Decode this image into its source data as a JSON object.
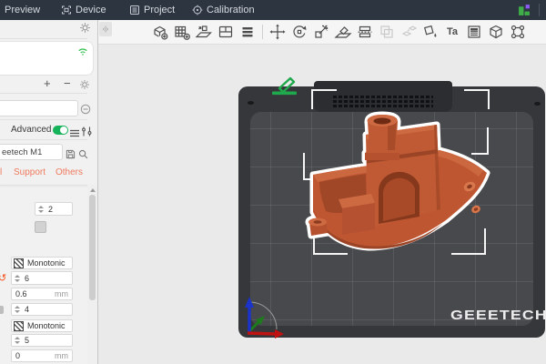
{
  "topbar": {
    "tabs": [
      {
        "label": "Preview"
      },
      {
        "label": "Device"
      },
      {
        "label": "Project"
      },
      {
        "label": "Calibration"
      }
    ]
  },
  "viewport_toolbar": {
    "text_icon_label": "Ta",
    "icons": [
      "add-object",
      "add-plate",
      "auto-arrange",
      "split-view",
      "layers",
      "move",
      "rotate",
      "scale",
      "lay-on-face",
      "cut",
      "clone",
      "split",
      "color-paint",
      "text",
      "variable-layer-height",
      "mesh-boolean",
      "seam"
    ]
  },
  "sidebar": {
    "plus_label": "+",
    "minus_label": "−",
    "advanced_label": "Advanced",
    "printer_value": "eetech M1",
    "tab_fragment": "l",
    "tabs": [
      {
        "label": "Support"
      },
      {
        "label": "Others"
      }
    ],
    "fields": [
      {
        "type": "spinner",
        "value": "2"
      },
      {
        "type": "select",
        "value": "Monotonic"
      },
      {
        "type": "spinner",
        "value": "6"
      },
      {
        "type": "number",
        "value": "0.6",
        "unit": "mm"
      },
      {
        "type": "spinner",
        "value": "4"
      },
      {
        "type": "select",
        "value": "Monotonic"
      },
      {
        "type": "spinner",
        "value": "5"
      },
      {
        "type": "number",
        "value": "0",
        "unit": "mm"
      }
    ]
  },
  "plate": {
    "logo": "GEEETECH"
  },
  "colors": {
    "topbar": "#2d3541",
    "tab_orange": "#ef7a5d",
    "toggle_green": "#17b35a",
    "model_orange": "#c05a35",
    "plate_dark": "#35373a",
    "pencil_green": "#1fa94c"
  }
}
